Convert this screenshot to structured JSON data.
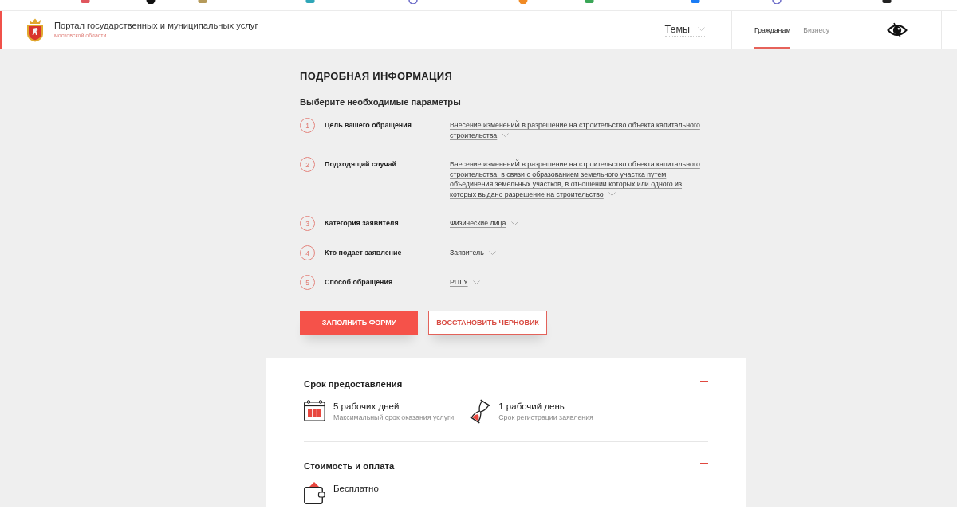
{
  "header": {
    "title": "Портал государственных и муниципальных услуг",
    "subtitle": "московской области",
    "topics": "Темы",
    "audience_tabs": [
      {
        "label": "Гражданам",
        "selected": true
      },
      {
        "label": "Бизнесу",
        "selected": false
      }
    ]
  },
  "details": {
    "title": "ПОДРОБНАЯ ИНФОРМАЦИЯ",
    "subtitle": "Выберите необходимые параметры",
    "parameters": [
      {
        "number": "1",
        "label": "Цель вашего обращения",
        "value": "Внесение изменениЙ в разрешение на строительство объекта капитального строительства"
      },
      {
        "number": "2",
        "label": "Подходящий случай",
        "value": "Внесение изменениЙ в разрешение на строительство объекта капитального строительства, в связи с образованием земельного участка путем объединения земельных участков, в отношении которых или одного из которых выдано разрешение на строительство"
      },
      {
        "number": "3",
        "label": "Категория заявителя",
        "value": "Физические лица"
      },
      {
        "number": "4",
        "label": "Кто подает заявление",
        "value": "Заявитель"
      },
      {
        "number": "5",
        "label": "Способ обращения",
        "value": "РПГУ"
      }
    ],
    "buttons": [
      {
        "label": "ЗАПОЛНИТЬ ФОРМУ",
        "kind": "primary"
      },
      {
        "label": "ВОССТАНОВИТЬ ЧЕРНОВИК",
        "kind": "secondary"
      }
    ]
  },
  "sections": [
    {
      "title": "Срок предоставления",
      "expanded": true,
      "items": [
        {
          "kind": "calendar",
          "value": "5 рабочих дней",
          "caption": "Максимальный срок оказания услуги"
        },
        {
          "kind": "hourglass",
          "value": "1 рабочий день",
          "caption": "Срок регистрации заявления"
        }
      ]
    },
    {
      "title": "Стоимость и оплата",
      "expanded": true,
      "items": [
        {
          "kind": "wallet",
          "value": "Бесплатно"
        }
      ]
    }
  ]
}
